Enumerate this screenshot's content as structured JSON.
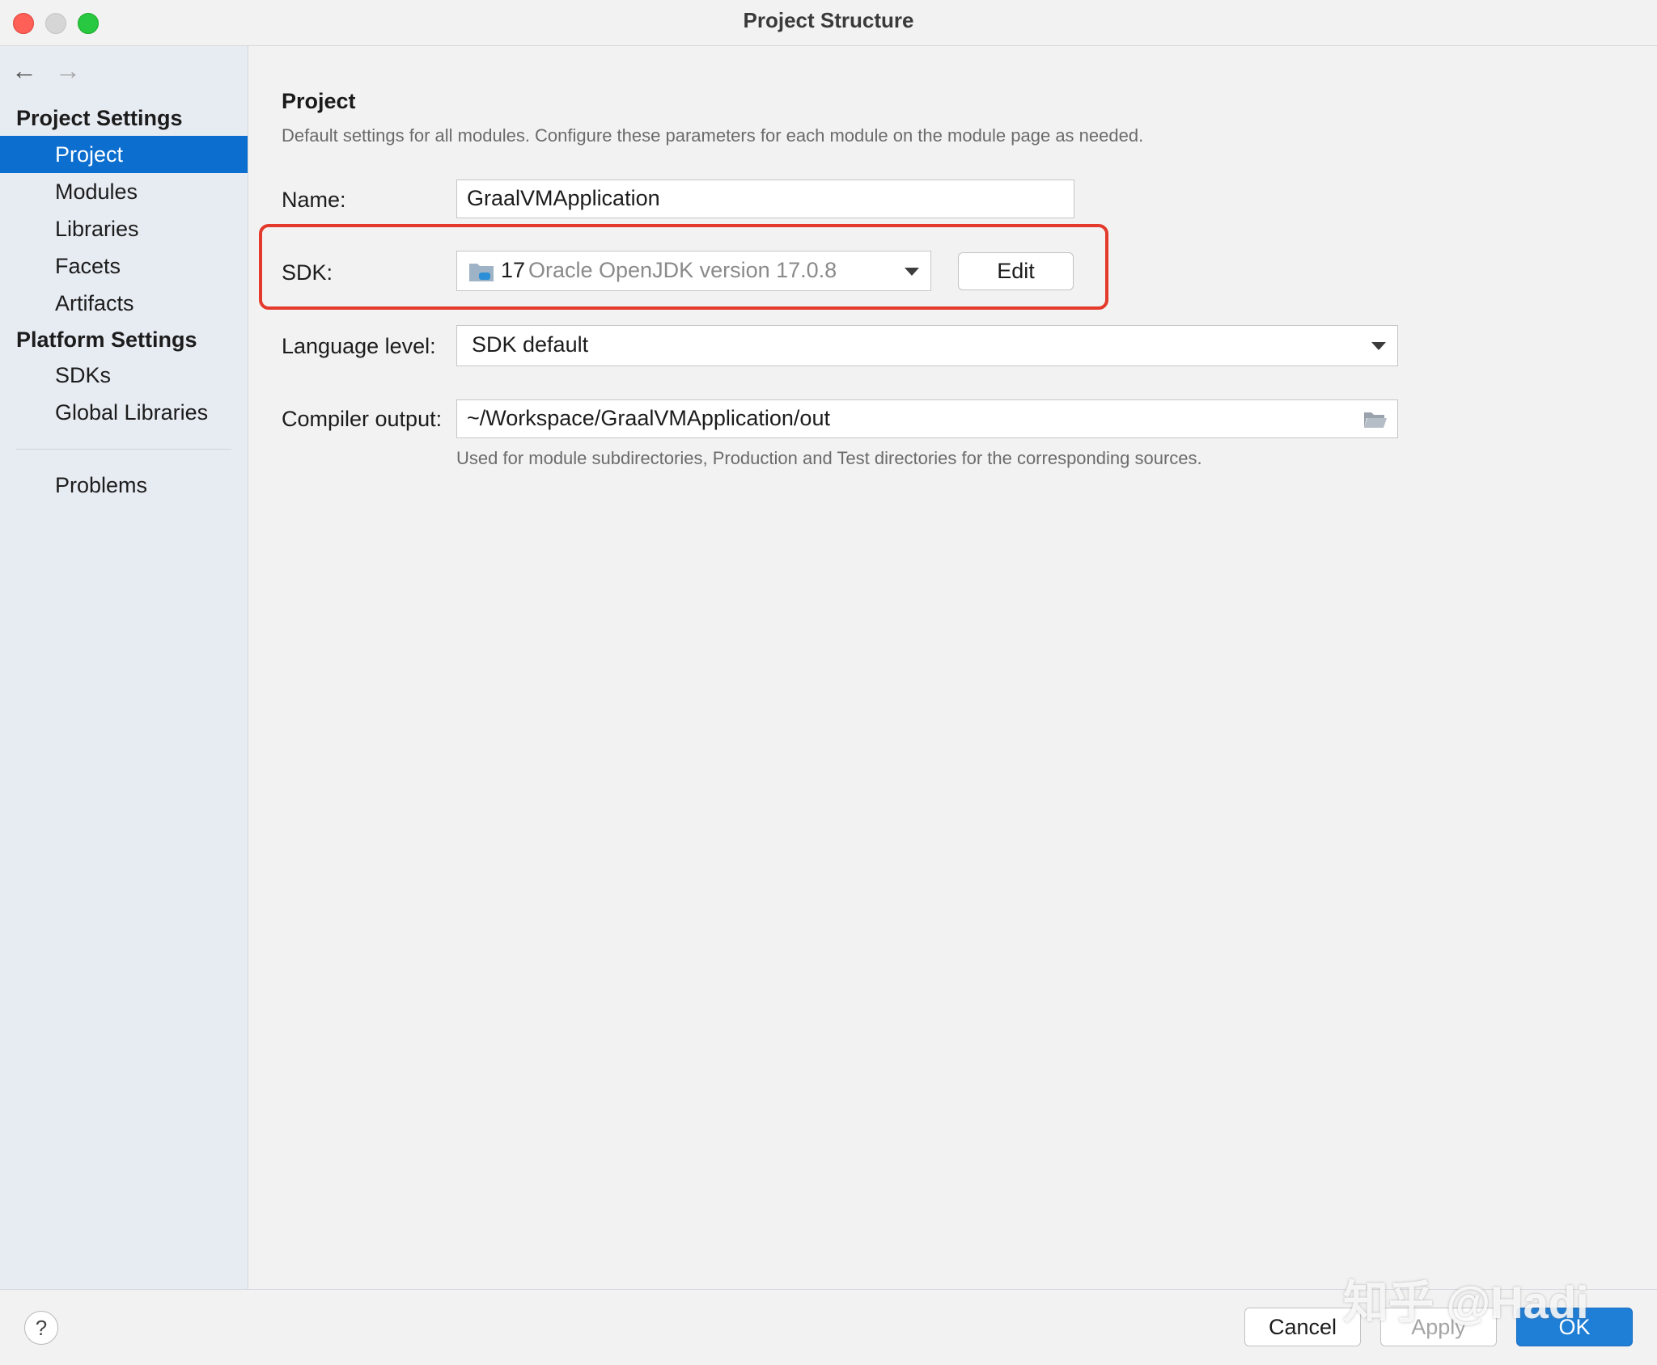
{
  "window": {
    "title": "Project Structure"
  },
  "nav": {
    "back_glyph": "←",
    "forward_glyph": "→"
  },
  "sidebar": {
    "project_settings_header": "Project Settings",
    "project_settings_items": [
      {
        "label": "Project",
        "selected": true
      },
      {
        "label": "Modules",
        "selected": false
      },
      {
        "label": "Libraries",
        "selected": false
      },
      {
        "label": "Facets",
        "selected": false
      },
      {
        "label": "Artifacts",
        "selected": false
      }
    ],
    "platform_settings_header": "Platform Settings",
    "platform_settings_items": [
      {
        "label": "SDKs"
      },
      {
        "label": "Global Libraries"
      }
    ],
    "problems_label": "Problems"
  },
  "main": {
    "title": "Project",
    "description": "Default settings for all modules. Configure these parameters for each module on the module page as needed.",
    "name_label": "Name:",
    "name_value": "GraalVMApplication",
    "sdk_label": "SDK:",
    "sdk_version": "17",
    "sdk_name": "Oracle OpenJDK version 17.0.8",
    "sdk_icon": "jdk-folder-icon",
    "edit_button": "Edit",
    "language_level_label": "Language level:",
    "language_level_value": "SDK default",
    "compiler_output_label": "Compiler output:",
    "compiler_output_value": "~/Workspace/GraalVMApplication/out",
    "compiler_output_hint": "Used for module subdirectories, Production and Test directories for the corresponding sources."
  },
  "footer": {
    "help_glyph": "?",
    "cancel_button": "Cancel",
    "apply_button": "Apply",
    "ok_button": "OK"
  },
  "watermark": "知乎 @Hadi",
  "colors": {
    "selection": "#0c6ecf",
    "highlight_box": "#e33a2c",
    "primary_button": "#1f7ed6"
  }
}
